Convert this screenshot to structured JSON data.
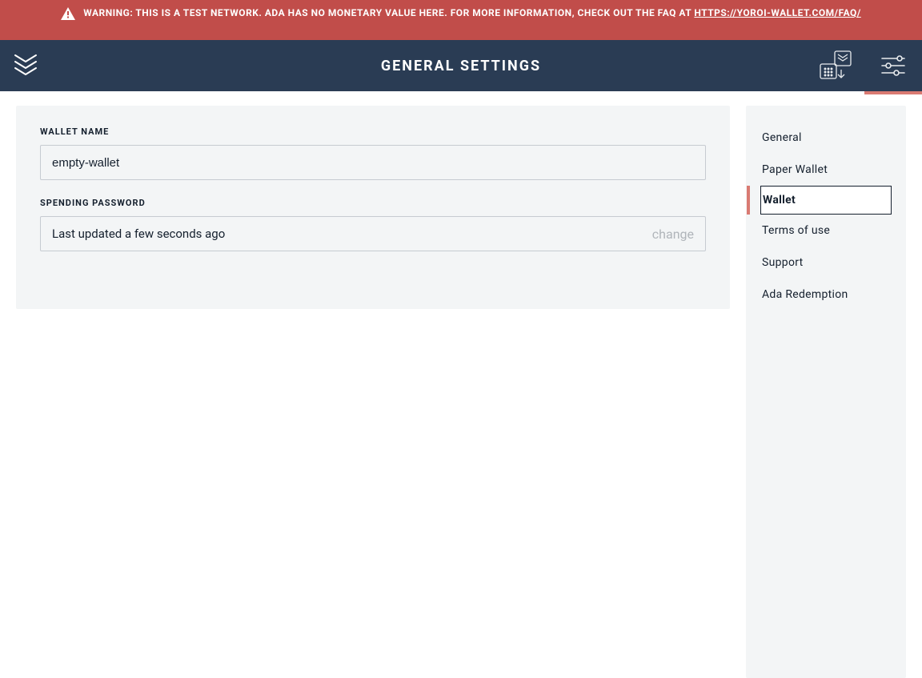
{
  "warning": {
    "prefix": "WARNING: THIS IS A TEST NETWORK. ADA HAS NO MONETARY VALUE HERE. FOR MORE INFORMATION, CHECK OUT THE FAQ AT ",
    "link_text": "HTTPS://YOROI-WALLET.COM/FAQ/"
  },
  "header": {
    "title": "GENERAL SETTINGS"
  },
  "form": {
    "wallet_name": {
      "label": "WALLET NAME",
      "value": "empty-wallet"
    },
    "spending_password": {
      "label": "SPENDING PASSWORD",
      "status": "Last updated a few seconds ago",
      "action": "change"
    }
  },
  "nav": {
    "items": [
      {
        "label": "General"
      },
      {
        "label": "Paper Wallet"
      },
      {
        "label": "Wallet",
        "active": true
      },
      {
        "label": "Terms of use"
      },
      {
        "label": "Support"
      },
      {
        "label": "Ada Redemption"
      }
    ]
  },
  "colors": {
    "warning_bg": "#c14d4a",
    "header_bg": "#2a3c54",
    "accent": "#d97a72",
    "panel_bg": "#f3f5f6"
  }
}
